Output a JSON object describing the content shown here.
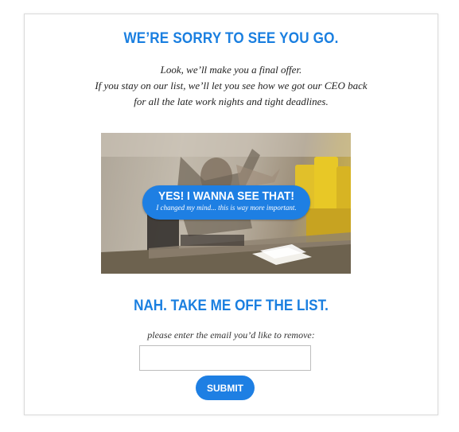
{
  "header": {
    "title": "WE’RE SORRY TO SEE YOU GO."
  },
  "offer": {
    "lines": [
      "Look, we’ll make you a final offer.",
      "If you stay on our list, we’ll let you see how we got our CEO back",
      "for all the late work nights and tight deadlines."
    ]
  },
  "cta": {
    "main_label": "YES! I WANNA SEE THAT!",
    "sub_label": "I changed my mind... this is way more important."
  },
  "unsubscribe": {
    "heading": "NAH. TAKE ME OFF THE LIST.",
    "prompt": "please enter the email you’d like to remove:",
    "email_value": "",
    "submit_label": "SUBMIT"
  },
  "colors": {
    "accent": "#1a7fe0",
    "button": "#1e7fe3"
  }
}
